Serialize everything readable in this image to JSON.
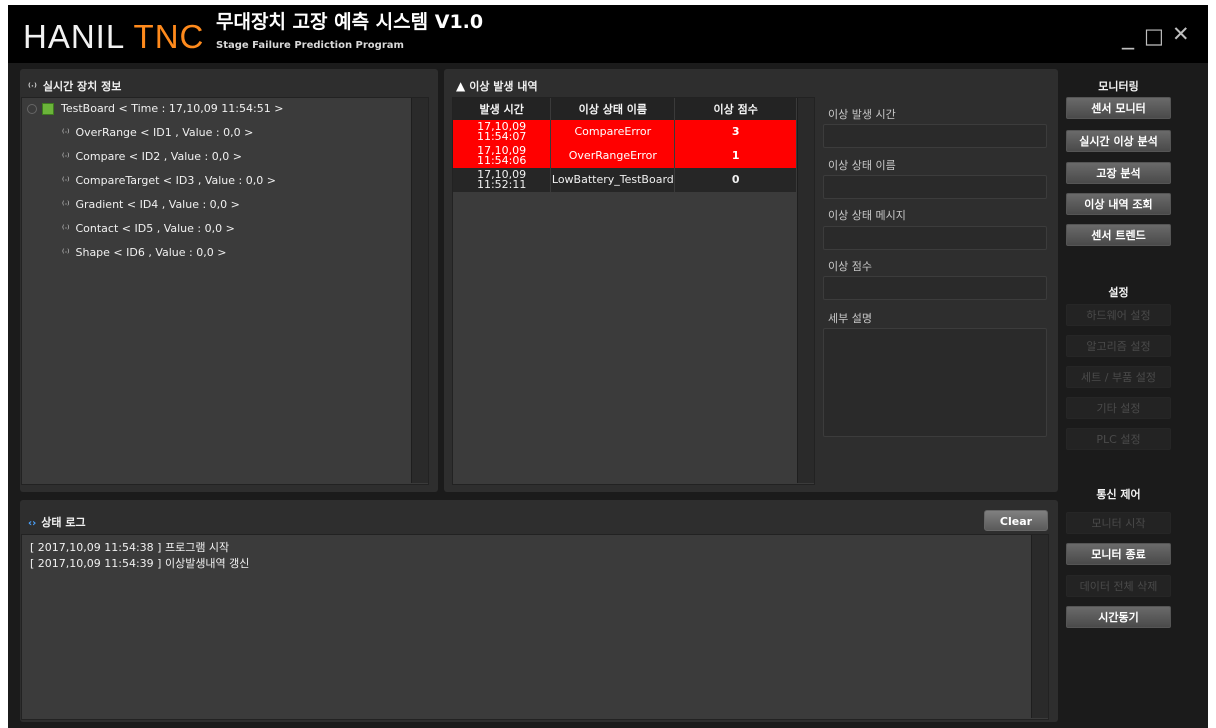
{
  "window": {
    "brand_main": "HANIL ",
    "brand_accent": "TNC",
    "title": "무대장치 고장 예측 시스템 V1.0",
    "subtitle": "Stage Failure Prediction Program",
    "minimize_glyph": "_",
    "maximize_glyph": "□",
    "close_glyph": "✕"
  },
  "device_panel": {
    "title": "실시간 장치 정보",
    "icon": "signal-icon",
    "root": "TestBoard < Time : 17,10,09 11:54:51 >",
    "children": [
      "OverRange < ID1 , Value : 0,0 >",
      "Compare < ID2 , Value : 0,0 >",
      "CompareTarget < ID3 , Value : 0,0 >",
      "Gradient < ID4 , Value : 0,0 >",
      "Contact < ID5 , Value : 0,0 >",
      "Shape < ID6 , Value : 0,0 >"
    ]
  },
  "alarm_panel": {
    "title": "이상 발생 내역",
    "icon": "warning-icon",
    "columns": [
      "발생 시간",
      "이상 상태 이름",
      "이상 점수"
    ],
    "rows": [
      {
        "date": "17,10,09",
        "time": "11:54:07",
        "name": "CompareError",
        "score": "3",
        "status": "error"
      },
      {
        "date": "17,10,09",
        "time": "11:54:06",
        "name": "OverRangeError",
        "score": "1",
        "status": "error"
      },
      {
        "date": "17,10,09",
        "time": "11:52:11",
        "name": "LowBattery_TestBoard",
        "score": "0",
        "status": "normal"
      }
    ],
    "status_colors": {
      "error": "#ff0000",
      "normal": "#262626"
    },
    "detail_fields": {
      "time_label": "이상 발생 시간",
      "name_label": "이상 상태 이름",
      "message_label": "이상 상태 메시지",
      "score_label": "이상 점수",
      "description_label": "세부 설명"
    }
  },
  "log_panel": {
    "title": "상태 로그",
    "icon": "code-icon",
    "clear_label": "Clear",
    "lines": [
      "[ 2017,10,09 11:54:38 ] 프로그램 시작",
      "[ 2017,10,09 11:54:39 ] 이상발생내역 갱신"
    ]
  },
  "sidebar": {
    "monitoring_header": "모니터링",
    "monitoring": [
      "센서 모니터",
      "실시간 이상 분석",
      "고장 분석",
      "이상 내역 조회",
      "센서 트렌드"
    ],
    "settings_header": "설정",
    "settings": [
      "하드웨어 설정",
      "알고리즘 설정",
      "세트 / 부품 설정",
      "기타 설정",
      "PLC 설정"
    ],
    "comm_header": "통신 제어",
    "comm": [
      {
        "label": "모니터 시작",
        "enabled": false
      },
      {
        "label": "모니터 종료",
        "enabled": true
      },
      {
        "label": "데이터 전체 삭제",
        "enabled": false
      },
      {
        "label": "시간동기",
        "enabled": true
      }
    ]
  },
  "colors": {
    "brand_accent": "#ff8a1c",
    "error_row": "#ff0000",
    "background": "#1b1b1b",
    "panel": "#2e2e2e"
  }
}
